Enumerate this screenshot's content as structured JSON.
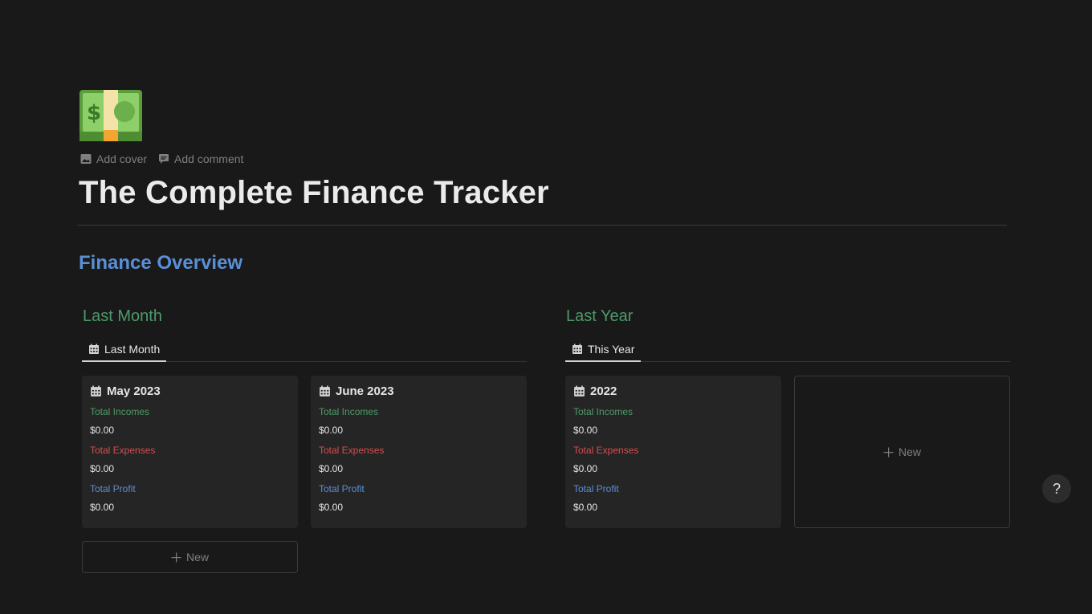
{
  "page": {
    "icon": "money-bill-icon",
    "add_cover": "Add cover",
    "add_comment": "Add comment",
    "title": "The Complete Finance Tracker",
    "heading": "Finance Overview"
  },
  "last_month": {
    "section_title": "Last Month",
    "tab_label": "Last Month",
    "cards": [
      {
        "title": "May 2023",
        "incomes_label": "Total Incomes",
        "incomes": "$0.00",
        "expenses_label": "Total Expenses",
        "expenses": "$0.00",
        "profit_label": "Total Profit",
        "profit": "$0.00"
      },
      {
        "title": "June 2023",
        "incomes_label": "Total Incomes",
        "incomes": "$0.00",
        "expenses_label": "Total Expenses",
        "expenses": "$0.00",
        "profit_label": "Total Profit",
        "profit": "$0.00"
      }
    ],
    "new_label": "New"
  },
  "last_year": {
    "section_title": "Last Year",
    "tab_label": "This Year",
    "cards": [
      {
        "title": "2022",
        "incomes_label": "Total Incomes",
        "incomes": "$0.00",
        "expenses_label": "Total Expenses",
        "expenses": "$0.00",
        "profit_label": "Total Profit",
        "profit": "$0.00"
      }
    ],
    "new_label": "New"
  },
  "help": {
    "label": "?"
  },
  "colors": {
    "background": "#191919",
    "income": "#4e9a6a",
    "expense": "#d64d4d",
    "profit": "#5a8fd6",
    "heading": "#5a8fd6"
  }
}
